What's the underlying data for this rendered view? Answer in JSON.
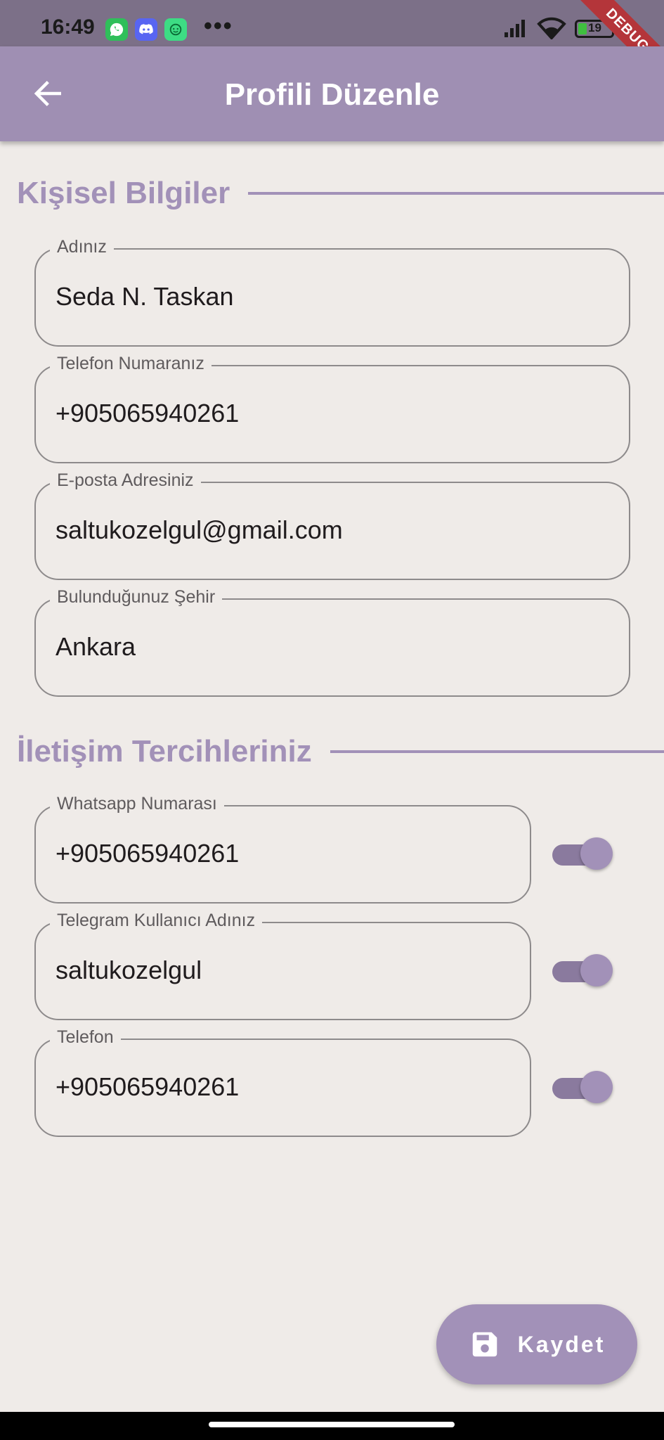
{
  "status_bar": {
    "time": "16:49",
    "more": "•••",
    "battery": "19",
    "notification_icons": [
      "whatsapp-icon",
      "discord-icon",
      "android-icon"
    ],
    "colors": {
      "whatsapp": "#2fbf5a",
      "discord": "#5865f2",
      "android": "#3ddc84"
    }
  },
  "debug_banner": "DEBUG",
  "appbar": {
    "title": "Profili Düzenle",
    "back_icon": "arrow-left-icon"
  },
  "sections": {
    "personal": "Kişisel Bilgiler",
    "contact": "İletişim Tercihleriniz"
  },
  "fields": [
    {
      "label": "Adınız",
      "value": "Seda N. Taskan"
    },
    {
      "label": "Telefon Numaranız",
      "value": "+905065940261"
    },
    {
      "label": "E-posta Adresiniz",
      "value": "saltukozelgul@gmail.com"
    },
    {
      "label": "Bulunduğunuz Şehir",
      "value": "Ankara"
    }
  ],
  "contact_fields": [
    {
      "label": "Whatsapp Numarası",
      "value": "+905065940261",
      "enabled": true
    },
    {
      "label": "Telegram Kullanıcı Adınız",
      "value": "saltukozelgul",
      "enabled": true
    },
    {
      "label": "Telefon",
      "value": "+905065940261",
      "enabled": true
    }
  ],
  "fab": {
    "label": "Kaydet",
    "icon": "save-icon"
  },
  "colors": {
    "accent": "#a291b8",
    "appbar": "#9f8fb3",
    "background": "#efebe8",
    "debug_banner": "#b4353a"
  }
}
